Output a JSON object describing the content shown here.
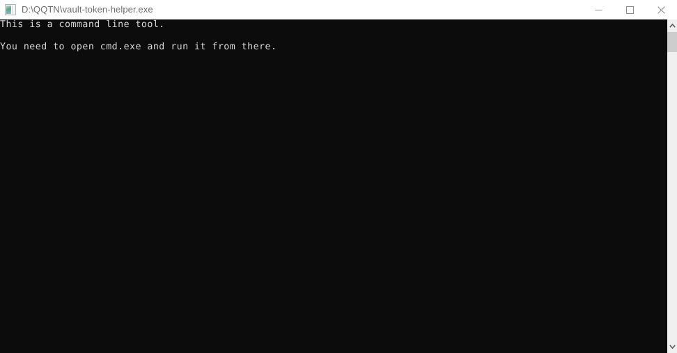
{
  "window": {
    "title": "D:\\QQTN\\vault-token-helper.exe",
    "icon": "console-app-icon",
    "background_color": "#ffffff",
    "titlebar_text_color": "#6d6d6d"
  },
  "caption_buttons": [
    {
      "name": "minimize",
      "label": "Minimize",
      "glyph": "minimize-icon"
    },
    {
      "name": "maximize",
      "label": "Maximize",
      "glyph": "maximize-icon"
    },
    {
      "name": "close",
      "label": "Close",
      "glyph": "close-icon"
    }
  ],
  "console": {
    "background_color": "#0c0c0c",
    "foreground_color": "#d8d8d8",
    "lines": [
      "This is a command line tool.",
      "",
      "You need to open cmd.exe and run it from there."
    ],
    "text": "This is a command line tool.\n\nYou need to open cmd.exe and run it from there."
  },
  "scrollbar": {
    "orientation": "vertical",
    "track_color": "#f0f0f0",
    "thumb_color": "#cdcdcd",
    "up_arrow": "chevron-up-icon",
    "down_arrow": "chevron-down-icon"
  }
}
